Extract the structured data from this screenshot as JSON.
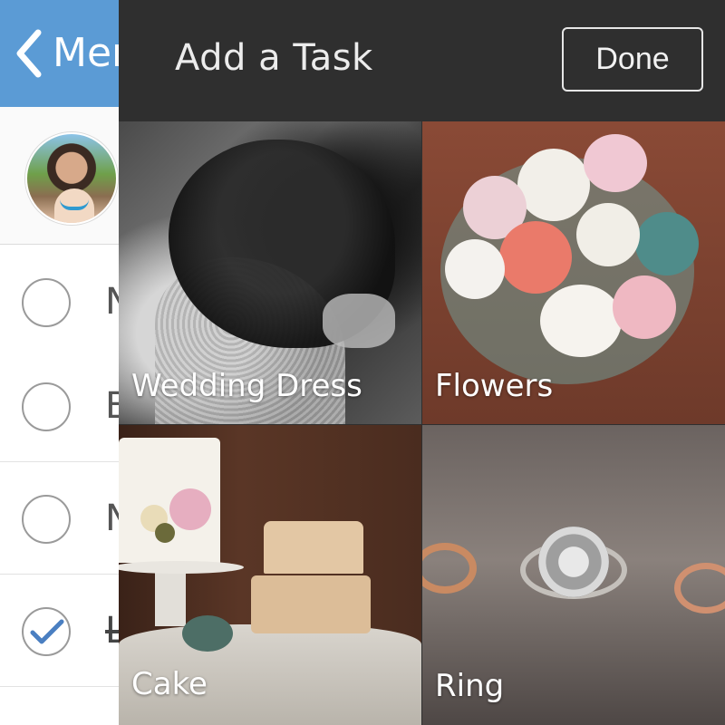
{
  "background_screen": {
    "header": {
      "back_label": "Mer",
      "color": "#5b9bd5"
    },
    "tasks": [
      {
        "label": "N",
        "checked": false
      },
      {
        "label": "B",
        "checked": false
      },
      {
        "label": "N",
        "checked": false
      },
      {
        "label": "L",
        "checked": true
      }
    ]
  },
  "overlay": {
    "title": "Add a Task",
    "done_label": "Done",
    "tiles": [
      {
        "label": "Wedding Dress"
      },
      {
        "label": "Flowers"
      },
      {
        "label": "Cake"
      },
      {
        "label": "Ring"
      }
    ]
  }
}
